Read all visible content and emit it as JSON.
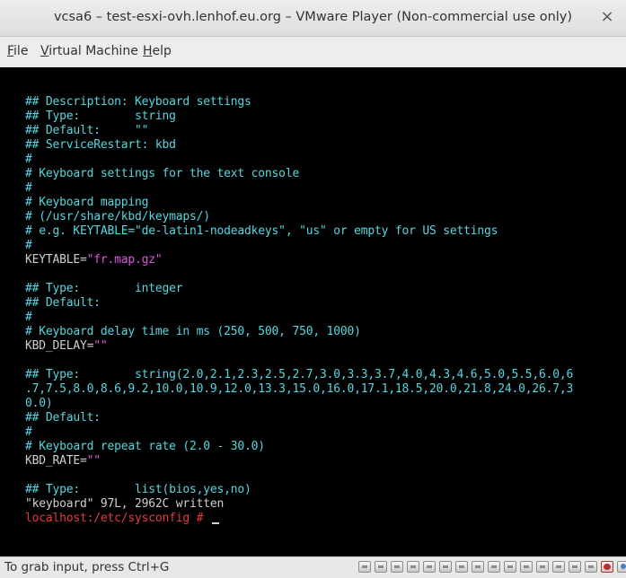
{
  "window": {
    "title": "vcsa6 – test-esxi-ovh.lenhof.eu.org – VMware Player (Non-commercial use only)",
    "close_glyph": "×"
  },
  "menu": [
    {
      "mnemonic": "F",
      "rest": "ile"
    },
    {
      "mnemonic": "V",
      "rest": "irtual Machine"
    },
    {
      "mnemonic": "H",
      "rest": "elp"
    }
  ],
  "console": {
    "lines": [
      [
        {
          "t": "## Description: Keyboard settings",
          "c": "cyan"
        }
      ],
      [
        {
          "t": "## Type:        string",
          "c": "cyan"
        }
      ],
      [
        {
          "t": "## Default:     \"\"",
          "c": "cyan"
        }
      ],
      [
        {
          "t": "## ServiceRestart: kbd",
          "c": "cyan"
        }
      ],
      [
        {
          "t": "#",
          "c": "cyan"
        }
      ],
      [
        {
          "t": "# Keyboard settings for the text console",
          "c": "cyan"
        }
      ],
      [
        {
          "t": "#",
          "c": "cyan"
        }
      ],
      [
        {
          "t": "# Keyboard mapping",
          "c": "cyan"
        }
      ],
      [
        {
          "t": "# (/usr/share/kbd/keymaps/)",
          "c": "cyan"
        }
      ],
      [
        {
          "t": "# e.g. KEYTABLE=\"de-latin1-nodeadkeys\", \"us\" or empty for US settings",
          "c": "cyan"
        }
      ],
      [
        {
          "t": "#",
          "c": "cyan"
        }
      ],
      [
        {
          "t": "KEYTABLE=",
          "c": "white"
        },
        {
          "t": "\"fr.map.gz\"",
          "c": "mag"
        }
      ],
      [
        {
          "t": "",
          "c": "white"
        }
      ],
      [
        {
          "t": "## Type:        integer",
          "c": "cyan"
        }
      ],
      [
        {
          "t": "## Default:",
          "c": "cyan"
        }
      ],
      [
        {
          "t": "#",
          "c": "cyan"
        }
      ],
      [
        {
          "t": "# Keyboard delay time in ms (250, 500, 750, 1000)",
          "c": "cyan"
        }
      ],
      [
        {
          "t": "KBD_DELAY=",
          "c": "white"
        },
        {
          "t": "\"\"",
          "c": "mag"
        }
      ],
      [
        {
          "t": "",
          "c": "white"
        }
      ],
      [
        {
          "t": "## Type:        string(2.0,2.1,2.3,2.5,2.7,3.0,3.3,3.7,4.0,4.3,4.6,5.0,5.5,6.0,6",
          "c": "cyan"
        }
      ],
      [
        {
          "t": ".7,7.5,8.0,8.6,9.2,10.0,10.9,12.0,13.3,15.0,16.0,17.1,18.5,20.0,21.8,24.0,26.7,3",
          "c": "cyan"
        }
      ],
      [
        {
          "t": "0.0)",
          "c": "cyan"
        }
      ],
      [
        {
          "t": "## Default:",
          "c": "cyan"
        }
      ],
      [
        {
          "t": "#",
          "c": "cyan"
        }
      ],
      [
        {
          "t": "# Keyboard repeat rate (2.0 - 30.0)",
          "c": "cyan"
        }
      ],
      [
        {
          "t": "KBD_RATE=",
          "c": "white"
        },
        {
          "t": "\"\"",
          "c": "mag"
        }
      ],
      [
        {
          "t": "",
          "c": "white"
        }
      ],
      [
        {
          "t": "## Type:        list(bios,yes,no)",
          "c": "cyan"
        }
      ],
      [
        {
          "t": "\"keyboard\" 97L, 2962C written",
          "c": "white"
        }
      ],
      [
        {
          "t": "localhost:/etc/sysconfig # ",
          "c": "red"
        }
      ]
    ]
  },
  "status": {
    "message": "To grab input, press Ctrl+G",
    "devices": [
      "hard-disk-icon",
      "hard-disk-icon",
      "hard-disk-icon",
      "hard-disk-icon",
      "hard-disk-icon",
      "hard-disk-icon",
      "hard-disk-icon",
      "hard-disk-icon",
      "hard-disk-icon",
      "hard-disk-icon",
      "cd-drive-icon",
      "network-icon",
      "usb-icon",
      "sound-icon",
      "printer-icon",
      "record-icon",
      "camera-icon",
      "message-icon"
    ]
  },
  "colors": {
    "cyan": "#55d7e1",
    "white": "#cfcfcf",
    "magenta": "#e055e0",
    "red": "#e53a3a"
  }
}
